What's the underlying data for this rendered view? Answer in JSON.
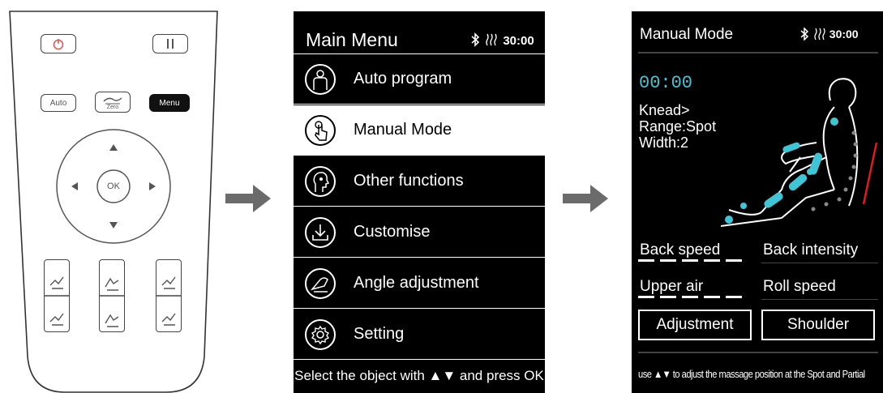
{
  "remote": {
    "buttons": {
      "auto": "Auto",
      "zero": "Zero",
      "menu": "Menu",
      "ok": "OK"
    }
  },
  "main_menu": {
    "title": "Main Menu",
    "timer": "30:00",
    "items": [
      {
        "label": "Auto program",
        "icon": "person-icon"
      },
      {
        "label": "Manual Mode",
        "icon": "touch-hand-icon",
        "selected": true
      },
      {
        "label": "Other functions",
        "icon": "head-icon"
      },
      {
        "label": "Customise",
        "icon": "download-icon"
      },
      {
        "label": "Angle adjustment",
        "icon": "recline-icon"
      },
      {
        "label": "Setting",
        "icon": "gear-icon"
      }
    ],
    "footer": "Select the object with ▲▼ and press OK"
  },
  "manual_mode": {
    "title": "Manual Mode",
    "timer": "30:00",
    "elapsed": "00:00",
    "info": [
      "Knead>",
      "Range:Spot",
      "Width:2"
    ],
    "options": [
      "Back speed",
      "Back intensity",
      "Upper air",
      "Roll speed"
    ],
    "back_speed_level": 5,
    "upper_air_level": 5,
    "buttons": [
      "Adjustment",
      "Shoulder"
    ],
    "footer": "use ▲▼ to adjust the massage position at the Spot and Partial",
    "accent_color": "#3ec6d6",
    "track_color": "#e01b1b"
  }
}
